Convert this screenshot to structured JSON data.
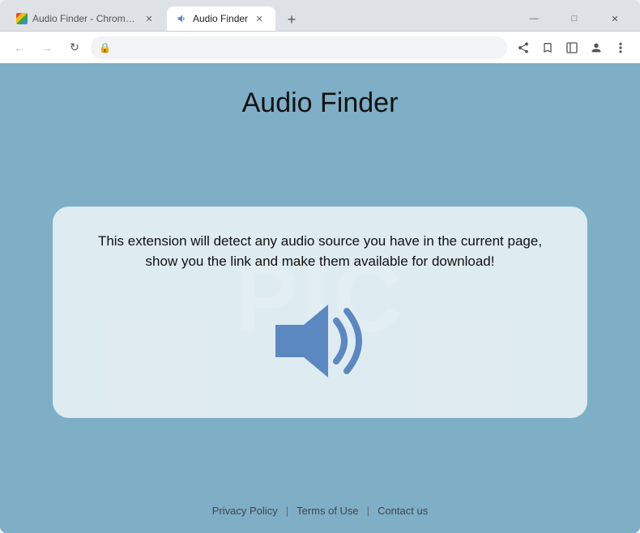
{
  "window": {
    "title": "Audio Finder - Chrome Web Store"
  },
  "tabs": [
    {
      "id": "tab-1",
      "label": "Audio Finder - Chrome Web …",
      "active": false,
      "favicon_type": "chrome"
    },
    {
      "id": "tab-2",
      "label": "Audio Finder",
      "active": true,
      "favicon_type": "audio"
    }
  ],
  "new_tab_label": "+",
  "window_controls": {
    "minimize": "—",
    "maximize": "□",
    "close": "✕"
  },
  "toolbar": {
    "back_label": "←",
    "forward_label": "→",
    "refresh_label": "↻",
    "address": "",
    "lock_icon": "🔒",
    "share_icon": "⎙",
    "bookmark_icon": "☆",
    "sidebar_icon": "▭",
    "profile_icon": "👤",
    "menu_icon": "⋮"
  },
  "page": {
    "title": "Audio Finder",
    "description": "This extension will detect any audio source you have in the current page, show you the link and make them available for download!",
    "watermark_text": "PIC"
  },
  "footer": {
    "privacy_policy": "Privacy Policy",
    "separator1": "|",
    "terms_of_use": "Terms of Use",
    "separator2": "|",
    "contact_us": "Contact us"
  }
}
